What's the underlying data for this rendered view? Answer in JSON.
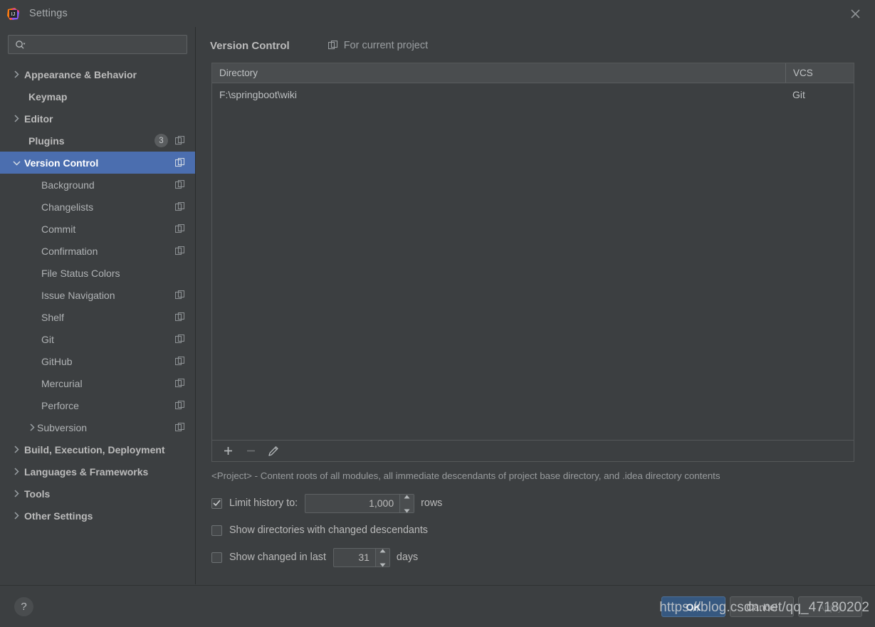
{
  "window": {
    "title": "Settings",
    "logo_icon": "intellij-idea-logo",
    "close_icon": "close-icon"
  },
  "sidebar": {
    "search": {
      "placeholder": "",
      "value": "",
      "icon": "search-icon",
      "dropdown_icon": "chevron-down-icon"
    },
    "items": [
      {
        "label": "Appearance & Behavior",
        "level": 0,
        "arrow": "chevron-right-icon",
        "bold": true,
        "copy": false,
        "badge": null,
        "selected": false
      },
      {
        "label": "Keymap",
        "level": 0,
        "arrow": null,
        "bold": true,
        "copy": false,
        "badge": null,
        "selected": false
      },
      {
        "label": "Editor",
        "level": 0,
        "arrow": "chevron-right-icon",
        "bold": true,
        "copy": false,
        "badge": null,
        "selected": false
      },
      {
        "label": "Plugins",
        "level": 0,
        "arrow": null,
        "bold": true,
        "copy": true,
        "badge": "3",
        "selected": false
      },
      {
        "label": "Version Control",
        "level": 0,
        "arrow": "chevron-down-icon",
        "bold": true,
        "copy": true,
        "badge": null,
        "selected": true
      },
      {
        "label": "Background",
        "level": 1,
        "arrow": null,
        "bold": false,
        "copy": true,
        "badge": null,
        "selected": false
      },
      {
        "label": "Changelists",
        "level": 1,
        "arrow": null,
        "bold": false,
        "copy": true,
        "badge": null,
        "selected": false
      },
      {
        "label": "Commit",
        "level": 1,
        "arrow": null,
        "bold": false,
        "copy": true,
        "badge": null,
        "selected": false
      },
      {
        "label": "Confirmation",
        "level": 1,
        "arrow": null,
        "bold": false,
        "copy": true,
        "badge": null,
        "selected": false
      },
      {
        "label": "File Status Colors",
        "level": 1,
        "arrow": null,
        "bold": false,
        "copy": false,
        "badge": null,
        "selected": false
      },
      {
        "label": "Issue Navigation",
        "level": 1,
        "arrow": null,
        "bold": false,
        "copy": true,
        "badge": null,
        "selected": false
      },
      {
        "label": "Shelf",
        "level": 1,
        "arrow": null,
        "bold": false,
        "copy": true,
        "badge": null,
        "selected": false
      },
      {
        "label": "Git",
        "level": 1,
        "arrow": null,
        "bold": false,
        "copy": true,
        "badge": null,
        "selected": false
      },
      {
        "label": "GitHub",
        "level": 1,
        "arrow": null,
        "bold": false,
        "copy": true,
        "badge": null,
        "selected": false
      },
      {
        "label": "Mercurial",
        "level": 1,
        "arrow": null,
        "bold": false,
        "copy": true,
        "badge": null,
        "selected": false
      },
      {
        "label": "Perforce",
        "level": 1,
        "arrow": null,
        "bold": false,
        "copy": true,
        "badge": null,
        "selected": false
      },
      {
        "label": "Subversion",
        "level": 1,
        "arrow": "chevron-right-icon",
        "bold": false,
        "copy": true,
        "badge": null,
        "selected": false
      },
      {
        "label": "Build, Execution, Deployment",
        "level": 0,
        "arrow": "chevron-right-icon",
        "bold": true,
        "copy": false,
        "badge": null,
        "selected": false
      },
      {
        "label": "Languages & Frameworks",
        "level": 0,
        "arrow": "chevron-right-icon",
        "bold": true,
        "copy": false,
        "badge": null,
        "selected": false
      },
      {
        "label": "Tools",
        "level": 0,
        "arrow": "chevron-right-icon",
        "bold": true,
        "copy": false,
        "badge": null,
        "selected": false
      },
      {
        "label": "Other Settings",
        "level": 0,
        "arrow": "chevron-right-icon",
        "bold": true,
        "copy": false,
        "badge": null,
        "selected": false
      }
    ]
  },
  "main": {
    "title": "Version Control",
    "scope_label": "For current project",
    "scope_icon": "copy-icon",
    "table": {
      "columns": [
        "Directory",
        "VCS"
      ],
      "rows": [
        {
          "directory": "F:\\springboot\\wiki",
          "vcs": "Git"
        }
      ]
    },
    "toolbar": {
      "add_label": "+",
      "remove_label": "−",
      "edit_icon": "pencil-icon",
      "add_icon": "plus-icon",
      "remove_icon": "minus-icon"
    },
    "hint": "<Project> - Content roots of all modules, all immediate descendants of project base directory, and .idea directory contents",
    "options": {
      "limit_history": {
        "label": "Limit history to:",
        "checked": true,
        "value": "1,000",
        "unit": "rows"
      },
      "show_directories": {
        "label": "Show directories with changed descendants",
        "checked": false
      },
      "show_changed_in_last": {
        "label": "Show changed in last",
        "checked": false,
        "value": "31",
        "unit": "days"
      }
    }
  },
  "footer": {
    "help_label": "?",
    "ok_label": "OK",
    "cancel_label": "Cancel",
    "apply_label": "Apply"
  },
  "watermark": "https://blog.csdn.net/qq_47180202",
  "colors": {
    "background": "#3c3f41",
    "selection": "#4b6eaf",
    "primary_button": "#365880",
    "text": "#bbbbbb",
    "muted_text": "#9a9ea1",
    "border": "#555859"
  }
}
